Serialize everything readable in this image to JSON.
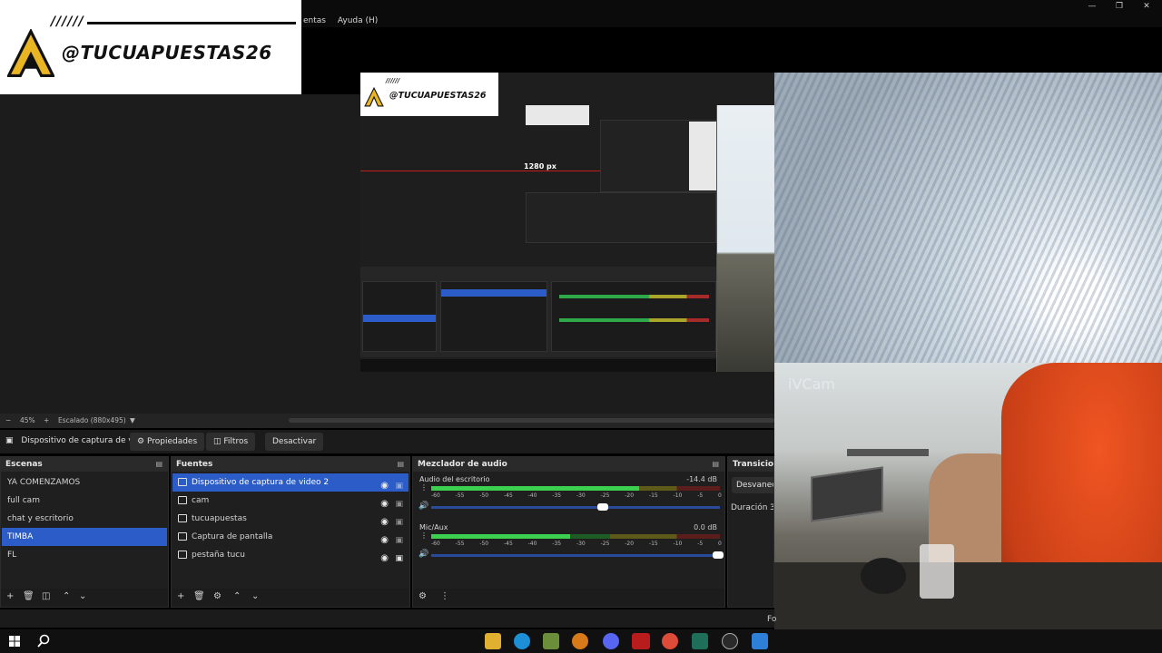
{
  "menu": {
    "items": [
      "entas",
      "Ayuda (H)"
    ]
  },
  "brand": {
    "hatch": "//////",
    "name": "@TUCUAPUESTAS26"
  },
  "preview": {
    "nested_brand_name": "@TUCUAPUESTAS26",
    "nested_hatch": "//////",
    "resolution_label": "1280 px"
  },
  "webcam": {
    "label": "iVCam"
  },
  "zoombar": {
    "minus": "−",
    "zoom": "45%",
    "plus": "+",
    "scale": "Escalado (880x495)"
  },
  "context": {
    "source_name": "Dispositivo de captura de v",
    "properties": "Propiedades",
    "filters": "Filtros",
    "deactivate": "Desactivar"
  },
  "scenes": {
    "title": "Escenas",
    "items": [
      {
        "label": "YA COMENZAMOS",
        "selected": false
      },
      {
        "label": "full cam",
        "selected": false
      },
      {
        "label": "chat y escritorio",
        "selected": false
      },
      {
        "label": "TIMBA",
        "selected": true
      },
      {
        "label": "FL",
        "selected": false
      }
    ]
  },
  "sources": {
    "title": "Fuentes",
    "items": [
      {
        "label": "Dispositivo de captura de video 2",
        "icon": "camera-icon",
        "selected": true
      },
      {
        "label": "cam",
        "icon": "camera-icon",
        "selected": false
      },
      {
        "label": "tucuapuestas",
        "icon": "image-icon",
        "selected": false
      },
      {
        "label": "Captura de pantalla",
        "icon": "monitor-icon",
        "selected": false
      },
      {
        "label": "pestaña tucu",
        "icon": "window-icon",
        "selected": false
      }
    ]
  },
  "mixer": {
    "title": "Mezclador de audio",
    "ticks": [
      "-60",
      "-55",
      "-50",
      "-45",
      "-40",
      "-35",
      "-30",
      "-25",
      "-20",
      "-15",
      "-10",
      "-5",
      "0"
    ],
    "channels": [
      {
        "name": "Audio del escritorio",
        "db": "-14.4 dB",
        "level": 0.72,
        "volume": 0.6
      },
      {
        "name": "Mic/Aux",
        "db": "0.0 dB",
        "level": 0.48,
        "volume": 1.0
      }
    ]
  },
  "transitions": {
    "title": "Transicion",
    "type": "Desvanec",
    "duration_label": "Duración",
    "duration_value": "3"
  },
  "status": {
    "partial": "Fo"
  },
  "colors": {
    "accent": "#2b5cc7",
    "meter_green": "#3cd04f",
    "recording_red": "#c01d1d"
  }
}
